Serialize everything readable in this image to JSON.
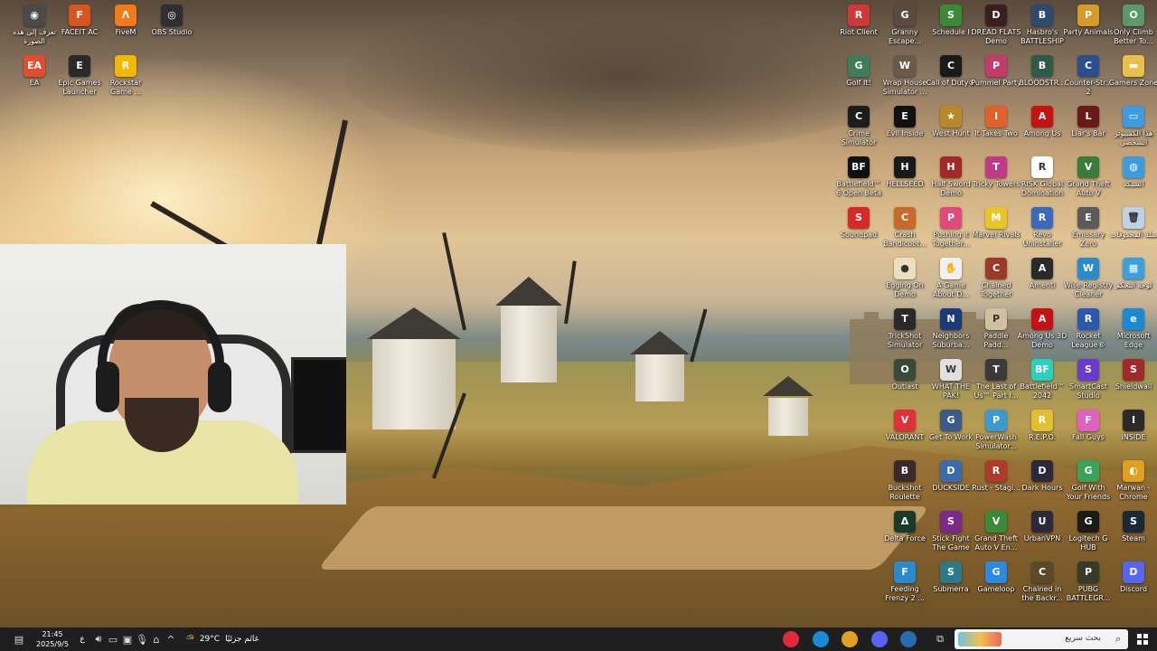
{
  "desktop": {
    "left_icons": [
      {
        "label": "تعرف إلى هذه الصورة",
        "icon": "camera-circle-icon",
        "color": "#4a4a4a",
        "glyph": "◉"
      },
      {
        "label": "FACEIT AC",
        "icon": "faceit-icon",
        "color": "#d9551f",
        "glyph": "F"
      },
      {
        "label": "FiveM",
        "icon": "fivem-icon",
        "color": "#f27a1a",
        "glyph": "Λ"
      },
      {
        "label": "OBS Studio",
        "icon": "obs-icon",
        "color": "#302e31",
        "glyph": "◎"
      },
      {
        "label": "EA",
        "icon": "ea-icon",
        "color": "#e44c2b",
        "glyph": "EA"
      },
      {
        "label": "Epic Games Launcher",
        "icon": "epic-games-icon",
        "color": "#2a2a2a",
        "glyph": "E"
      },
      {
        "label": "Rockstar Game ...",
        "icon": "rockstar-icon",
        "color": "#f5b800",
        "glyph": "R"
      }
    ],
    "right_icons": [
      [
        {
          "label": "Riot Client",
          "icon": "riot-icon",
          "color": "#d13639",
          "glyph": "R"
        },
        {
          "label": "Granny Escape...",
          "icon": "granny-icon",
          "color": "#5a4b40",
          "glyph": "G"
        },
        {
          "label": "Schedule I",
          "icon": "schedule-icon",
          "color": "#3a8a3a",
          "glyph": "S"
        },
        {
          "label": "DREAD FLATS Demo",
          "icon": "dread-flats-icon",
          "color": "#3b1f1f",
          "glyph": "D"
        },
        {
          "label": "Hasbro's BATTLESHIP",
          "icon": "battleship-icon",
          "color": "#2e4a6e",
          "glyph": "B"
        },
        {
          "label": "Party Animals",
          "icon": "party-animals-icon",
          "color": "#d69a2a",
          "glyph": "P"
        },
        {
          "label": "Only Climb Better To...",
          "icon": "only-climb-icon",
          "color": "#5a9a6a",
          "glyph": "O"
        }
      ],
      [
        {
          "label": "Golf It!",
          "icon": "golf-it-icon",
          "color": "#3e7d5a",
          "glyph": "G"
        },
        {
          "label": "Wrap House Simulator ...",
          "icon": "wrap-house-icon",
          "color": "#6a5a4a",
          "glyph": "W"
        },
        {
          "label": "Call of Duty®",
          "icon": "call-of-duty-icon",
          "color": "#1a1a1a",
          "glyph": "C"
        },
        {
          "label": "Pummel Party",
          "icon": "pummel-party-icon",
          "color": "#c23b6a",
          "glyph": "P"
        },
        {
          "label": "BLOODSTR...",
          "icon": "bloodstrike-icon",
          "color": "#2e5a4a",
          "glyph": "B"
        },
        {
          "label": "Counter-Str... 2",
          "icon": "counter-strike-icon",
          "color": "#2b4e8c",
          "glyph": "C"
        },
        {
          "label": "Gamers Zone",
          "icon": "folder-icon",
          "color": "#e8c04a",
          "glyph": "▬"
        }
      ],
      [
        {
          "label": "Crime Simulator",
          "icon": "crime-sim-icon",
          "color": "#1d1d1d",
          "glyph": "C"
        },
        {
          "label": "Evil Inside",
          "icon": "evil-inside-icon",
          "color": "#111111",
          "glyph": "E"
        },
        {
          "label": "West Hunt",
          "icon": "west-hunt-icon",
          "color": "#b8892a",
          "glyph": "★"
        },
        {
          "label": "It Takes Two",
          "icon": "it-takes-two-icon",
          "color": "#e0622a",
          "glyph": "I"
        },
        {
          "label": "Among Us",
          "icon": "among-us-icon",
          "color": "#c51111",
          "glyph": "A"
        },
        {
          "label": "Liar's Bar",
          "icon": "liars-bar-icon",
          "color": "#6a1a1a",
          "glyph": "L"
        },
        {
          "label": "هذا الكمبيوتر الشخصي",
          "icon": "this-pc-icon",
          "color": "#3d9be0",
          "glyph": "▭"
        }
      ],
      [
        {
          "label": "Battlefield™ 6 Open Beta",
          "icon": "battlefield-6-icon",
          "color": "#111111",
          "glyph": "BF"
        },
        {
          "label": "HELLSEED",
          "icon": "hellseed-icon",
          "color": "#1a1a1a",
          "glyph": "H"
        },
        {
          "label": "Half Sword Demo",
          "icon": "half-sword-icon",
          "color": "#a02a2a",
          "glyph": "H"
        },
        {
          "label": "Tricky Towers",
          "icon": "tricky-towers-icon",
          "color": "#c03a8a",
          "glyph": "T"
        },
        {
          "label": "RISK Global Domination",
          "icon": "risk-icon",
          "color": "#ffffff",
          "glyph": "R"
        },
        {
          "label": "Grand Theft Auto V",
          "icon": "gta-v-icon",
          "color": "#3a7a3a",
          "glyph": "V"
        },
        {
          "label": "الشبكة",
          "icon": "network-icon",
          "color": "#3d9be0",
          "glyph": "◍"
        }
      ],
      [
        {
          "label": "Soundpad",
          "icon": "soundpad-icon",
          "color": "#d62a2a",
          "glyph": "S"
        },
        {
          "label": "Crash Bandicoot...",
          "icon": "crash-icon",
          "color": "#c76a2a",
          "glyph": "C"
        },
        {
          "label": "Pushing it Together...",
          "icon": "pushing-together-icon",
          "color": "#e04a7a",
          "glyph": "P"
        },
        {
          "label": "Marvel Rivals",
          "icon": "marvel-rivals-icon",
          "color": "#e8c62a",
          "glyph": "M"
        },
        {
          "label": "Revo Uninstaller",
          "icon": "revo-icon",
          "color": "#3a6ac0",
          "glyph": "R"
        },
        {
          "label": "Emissary Zero",
          "icon": "emissary-zero-icon",
          "color": "#5a5a5a",
          "glyph": "E"
        },
        {
          "label": "سلة المحذوفات",
          "icon": "recycle-bin-icon",
          "color": "#bcd2e6",
          "glyph": "🗑"
        }
      ],
      [
        {
          "label": "Egging On Demo",
          "icon": "egging-on-icon",
          "color": "#eae0c0",
          "glyph": "●"
        },
        {
          "label": "A Game About D...",
          "icon": "game-about-icon",
          "color": "#f0f0f0",
          "glyph": "✋"
        },
        {
          "label": "Chained Together",
          "icon": "chained-together-icon",
          "color": "#9a3a2a",
          "glyph": "C"
        },
        {
          "label": "Amenti",
          "icon": "amenti-icon",
          "color": "#2a2a2a",
          "glyph": "A"
        },
        {
          "label": "Wise Registry Cleaner",
          "icon": "wise-registry-icon",
          "color": "#2a8ad0",
          "glyph": "W"
        },
        {
          "label": "لوحة التحكم",
          "icon": "control-panel-icon",
          "color": "#3aa0e0",
          "glyph": "▦"
        }
      ],
      [
        {
          "label": "TrickShot Simulator",
          "icon": "trickshot-icon",
          "color": "#2a2a2a",
          "glyph": "T"
        },
        {
          "label": "Neighbors Suburba...",
          "icon": "neighbors-icon",
          "color": "#1a3a7a",
          "glyph": "N"
        },
        {
          "label": "Paddle Padd...",
          "icon": "paddle-icon",
          "color": "#d0c0a0",
          "glyph": "P"
        },
        {
          "label": "Among Us 3D Demo",
          "icon": "among-us-3d-icon",
          "color": "#c51111",
          "glyph": "A"
        },
        {
          "label": "Rocket League®",
          "icon": "rocket-league-icon",
          "color": "#2a5ab0",
          "glyph": "R"
        },
        {
          "label": "Microsoft Edge",
          "icon": "edge-icon",
          "color": "#1b8ad6",
          "glyph": "e"
        }
      ],
      [
        {
          "label": "Outlast",
          "icon": "outlast-icon",
          "color": "#3a4a3a",
          "glyph": "O"
        },
        {
          "label": "WHAT THE PAK!",
          "icon": "what-the-pak-icon",
          "color": "#e0e0e0",
          "glyph": "W"
        },
        {
          "label": "The Last of Us™ Part I...",
          "icon": "last-of-us-icon",
          "color": "#3a3a3a",
          "glyph": "T"
        },
        {
          "label": "Battlefield™ 2042",
          "icon": "battlefield-2042-icon",
          "color": "#2ad0c0",
          "glyph": "BF"
        },
        {
          "label": "SmartCast Studio",
          "icon": "smartcast-icon",
          "color": "#6a3ad0",
          "glyph": "S"
        },
        {
          "label": "Shieldwall",
          "icon": "shieldwall-icon",
          "color": "#a02a2a",
          "glyph": "S"
        }
      ],
      [
        {
          "label": "VALORANT",
          "icon": "valorant-icon",
          "color": "#e0303a",
          "glyph": "V"
        },
        {
          "label": "Get To Work",
          "icon": "get-to-work-icon",
          "color": "#3a5a8a",
          "glyph": "G"
        },
        {
          "label": "PowerWash Simulator...",
          "icon": "powerwash-icon",
          "color": "#3a9ad0",
          "glyph": "P"
        },
        {
          "label": "R.E.P.O.",
          "icon": "repo-icon",
          "color": "#e0c030",
          "glyph": "R"
        },
        {
          "label": "Fall Guys",
          "icon": "fall-guys-icon",
          "color": "#e060c0",
          "glyph": "F"
        },
        {
          "label": "INSIDE",
          "icon": "inside-icon",
          "color": "#2a2a2a",
          "glyph": "I"
        }
      ],
      [
        {
          "label": "Buckshot Roulette",
          "icon": "buckshot-icon",
          "color": "#3a2a2a",
          "glyph": "B"
        },
        {
          "label": "DUCKSIDE",
          "icon": "duckside-icon",
          "color": "#3a6ab0",
          "glyph": "D"
        },
        {
          "label": "Rust - Stagi...",
          "icon": "rust-icon",
          "color": "#b03a2a",
          "glyph": "R"
        },
        {
          "label": "Dark Hours",
          "icon": "dark-hours-icon",
          "color": "#2a2a3a",
          "glyph": "D"
        },
        {
          "label": "Golf With Your Friends",
          "icon": "golf-friends-icon",
          "color": "#3aa05a",
          "glyph": "G"
        },
        {
          "label": "Marwan - Chrome",
          "icon": "chrome-icon",
          "color": "#e0a020",
          "glyph": "◐"
        }
      ],
      [
        {
          "label": "Delta Force",
          "icon": "delta-force-icon",
          "color": "#1a3a2a",
          "glyph": "Δ"
        },
        {
          "label": "Stick Fight The Game",
          "icon": "stick-fight-icon",
          "color": "#7a2a8a",
          "glyph": "S"
        },
        {
          "label": "Grand Theft Auto V En...",
          "icon": "gta-v-enhanced-icon",
          "color": "#3a8a3a",
          "glyph": "V"
        },
        {
          "label": "UrbanVPN",
          "icon": "urbanvpn-icon",
          "color": "#2a2a3a",
          "glyph": "U"
        },
        {
          "label": "Logitech G HUB",
          "icon": "logitech-icon",
          "color": "#1a1a1a",
          "glyph": "G"
        },
        {
          "label": "Steam",
          "icon": "steam-icon",
          "color": "#1b2838",
          "glyph": "S"
        }
      ],
      [
        {
          "label": "Feeding Frenzy 2 ...",
          "icon": "feeding-frenzy-icon",
          "color": "#2a8ad0",
          "glyph": "F"
        },
        {
          "label": "Submerra",
          "icon": "submerra-icon",
          "color": "#2a7a8a",
          "glyph": "S"
        },
        {
          "label": "Gameloop",
          "icon": "gameloop-icon",
          "color": "#2a8ae0",
          "glyph": "G"
        },
        {
          "label": "Chained in the Backr...",
          "icon": "chained-backrooms-icon",
          "color": "#5a4a2a",
          "glyph": "C"
        },
        {
          "label": "PUBG BATTLEGR...",
          "icon": "pubg-icon",
          "color": "#3a3a2a",
          "glyph": "P"
        },
        {
          "label": "Discord",
          "icon": "discord-icon",
          "color": "#5865f2",
          "glyph": "D"
        }
      ]
    ]
  },
  "taskbar": {
    "clock_time": "21:45",
    "clock_date": "2025/9/5",
    "language": "ع",
    "weather_temp": "29°C",
    "weather_text": "غائم جزئيًا",
    "search_placeholder": "بحث سريع",
    "apps": [
      {
        "icon": "opera-gx-icon",
        "color": "#e02a3a"
      },
      {
        "icon": "edge-icon",
        "color": "#1b8ad6"
      },
      {
        "icon": "chrome-icon",
        "color": "#e0a020"
      },
      {
        "icon": "discord-icon",
        "color": "#5865f2"
      },
      {
        "icon": "steam-icon",
        "color": "#2a6ab0"
      }
    ]
  }
}
